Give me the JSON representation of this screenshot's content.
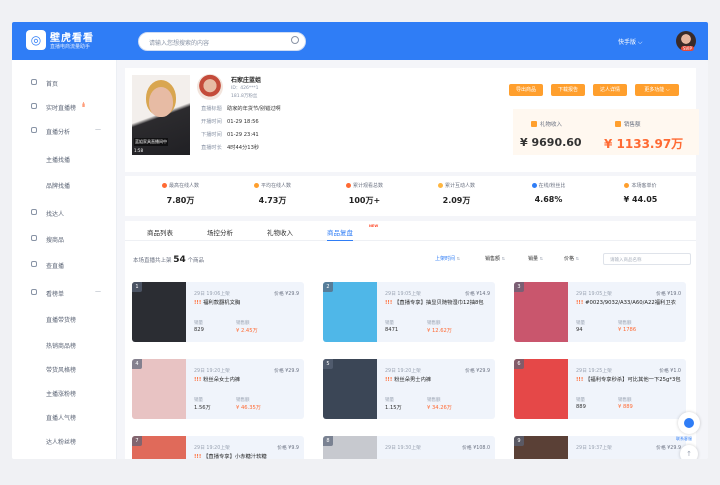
{
  "header": {
    "logo_glyph": "◎",
    "app_name": "壁虎看看",
    "app_sub": "直播电商流量助手",
    "search_placeholder": "请输入您想搜索的内容",
    "user_menu": "快手版 ⌵",
    "vip": "SVIP"
  },
  "sidebar": {
    "items": [
      {
        "label": "首页",
        "icon": "home-icon"
      },
      {
        "label": "实时直播榜",
        "icon": "live-icon",
        "hot": "ılı"
      },
      {
        "label": "直播分析",
        "icon": "analysis-icon",
        "chev": "—"
      },
      {
        "label": "主播找播"
      },
      {
        "label": "品牌找播"
      },
      {
        "label": "找达人",
        "icon": "person-icon"
      },
      {
        "label": "搜商品",
        "icon": "goods-icon"
      },
      {
        "label": "查直播",
        "icon": "search-live-icon"
      },
      {
        "label": "看榜单",
        "icon": "rank-icon",
        "chev": "—"
      },
      {
        "label": "直播带货榜"
      },
      {
        "label": "热销商品榜"
      },
      {
        "label": "带货风格榜"
      },
      {
        "label": "主播涨粉榜"
      },
      {
        "label": "直播人气榜"
      },
      {
        "label": "达人粉丝榜"
      }
    ]
  },
  "profile": {
    "name": "石家庄蓝姐",
    "id": "ID：426***1",
    "fans": "181.8万粉丝",
    "cover_caption": "蓝姐家具直播间中",
    "cover_duration": "1:58",
    "meta": [
      {
        "k": "直播标题",
        "v": "助家的年货节/别错过啊"
      },
      {
        "k": "开播时间",
        "v": "01-29 18:56"
      },
      {
        "k": "下播时间",
        "v": "01-29 23:41"
      },
      {
        "k": "直播时长",
        "v": "4时44分13秒"
      }
    ],
    "buttons": [
      "导出商品",
      "下载报告",
      "达人详情",
      "更多功能 ⌵"
    ],
    "revenue": [
      {
        "k": "礼物收入",
        "v": "¥ 9690.60"
      },
      {
        "k": "销售额",
        "v": "¥ 1133.97万"
      }
    ]
  },
  "stats": [
    {
      "k": "最高在线人数",
      "v": "7.80万",
      "c": "#ff6a33"
    },
    {
      "k": "平均在线人数",
      "v": "4.73万",
      "c": "#ff9f2d"
    },
    {
      "k": "累计观看总数",
      "v": "100万+",
      "c": "#ff6a33"
    },
    {
      "k": "累计互动人数",
      "v": "2.09万",
      "c": "#ffb640"
    },
    {
      "k": "在线/粉丝比",
      "v": "4.68%",
      "c": "#2f7df6"
    },
    {
      "k": "本场客单价",
      "v": "¥ 44.05",
      "c": "#ff9f2d"
    }
  ],
  "tabs": [
    "商品列表",
    "场控分析",
    "礼物收入",
    "商品复盘"
  ],
  "tab_new": "NEW",
  "goods": {
    "count_prefix": "本场直播共上架",
    "count": "54",
    "count_suffix": "个商品",
    "sorts": [
      {
        "label": "上架时间",
        "active": true
      },
      {
        "label": "销售额"
      },
      {
        "label": "销量"
      },
      {
        "label": "价格"
      }
    ],
    "search_placeholder": "请输入商品名称",
    "cards": [
      {
        "rank": "1",
        "time": "29日 19:06上架",
        "price": "价格 ¥29.9",
        "title": "福利款翻机文胸",
        "s1": "829",
        "s2": "¥ 2.45万",
        "thumb": "#2b2d33"
      },
      {
        "rank": "2",
        "time": "29日 19:05上架",
        "price": "价格 ¥14.9",
        "title": "【直播专享】抽显贝随物湿巾12抽8包",
        "s1": "8471",
        "s2": "¥ 12.62万",
        "thumb": "#4fb7e8"
      },
      {
        "rank": "3",
        "time": "29日 19:05上架",
        "price": "价格 ¥19.0",
        "title": "#0023/9032/A33/A60/A22福利卫衣",
        "s1": "94",
        "s2": "¥ 1786",
        "thumb": "#c9566d"
      },
      {
        "rank": "4",
        "time": "29日 19:20上架",
        "price": "价格 ¥29.9",
        "title": "粉丝朵女士内裤",
        "s1": "1.56万",
        "s2": "¥ 46.35万",
        "thumb": "#e8c3c3"
      },
      {
        "rank": "5",
        "time": "29日 19:20上架",
        "price": "价格 ¥29.9",
        "title": "粉丝朵男士内裤",
        "s1": "1.15万",
        "s2": "¥ 34.26万",
        "thumb": "#3b4656"
      },
      {
        "rank": "6",
        "time": "29日 19:25上架",
        "price": "价格 ¥1.0",
        "title": "【福利专享秒杀】可比其他一下25g*3包",
        "s1": "889",
        "s2": "¥ 889",
        "thumb": "#e54848"
      },
      {
        "rank": "7",
        "time": "29日 19:20上架",
        "price": "价格 ¥9.9",
        "title": "【直播专享】小赤糖汁软糖",
        "s1": "",
        "s2": "",
        "thumb": "#e06a5a"
      },
      {
        "rank": "8",
        "time": "29日 19:30上架",
        "price": "价格 ¥108.0",
        "title": "",
        "s1": "",
        "s2": "",
        "thumb": "#c7c9cf"
      },
      {
        "rank": "9",
        "time": "29日 19:37上架",
        "price": "价格 ¥29.9",
        "title": "",
        "s1": "",
        "s2": "",
        "thumb": "#5a4036"
      }
    ],
    "k1": "销量",
    "k2": "销售额"
  },
  "float": {
    "cs_label": "联系客服",
    "top_glyph": "↑"
  }
}
